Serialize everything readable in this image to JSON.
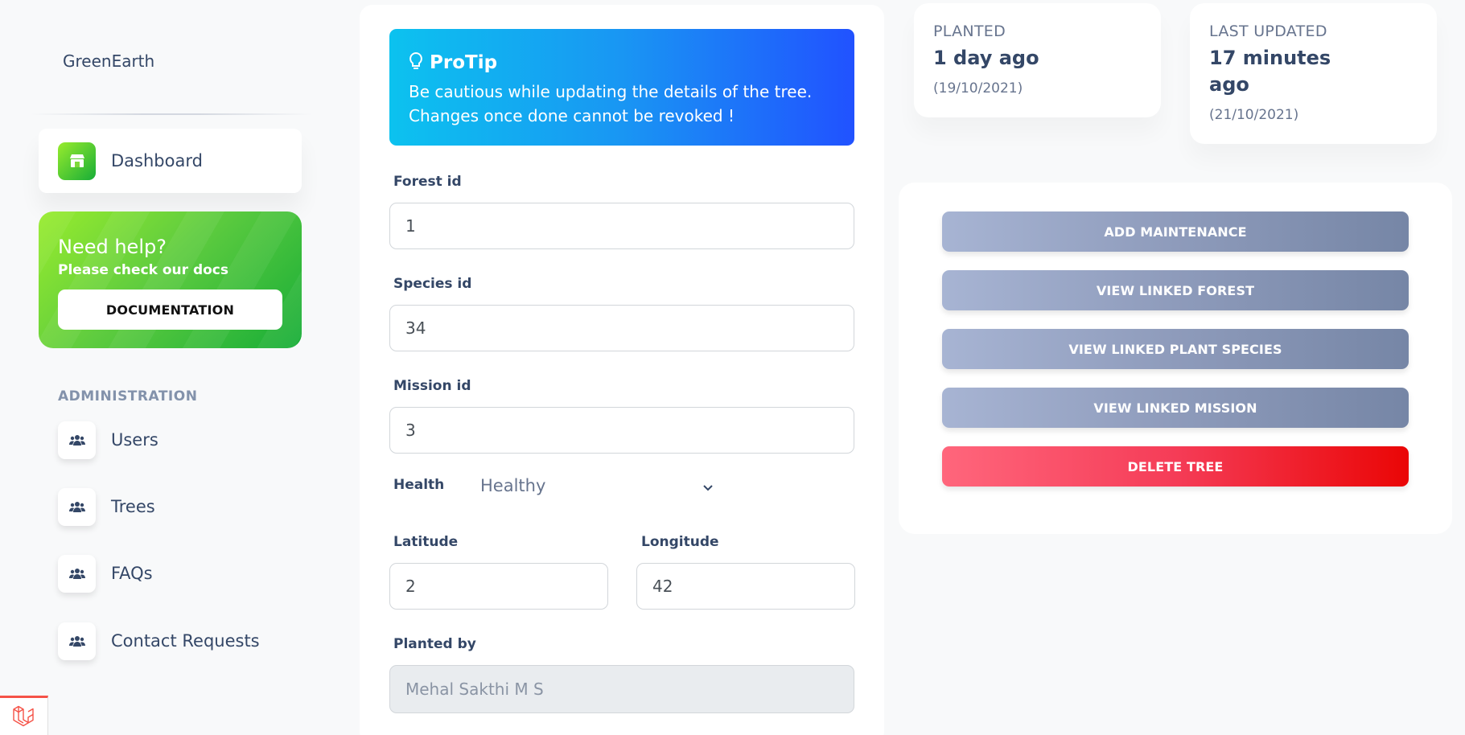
{
  "sidebar": {
    "brand": "GreenEarth",
    "active_item": {
      "label": "Dashboard",
      "icon": "shop-icon"
    },
    "help": {
      "title": "Need help?",
      "subtitle": "Please check our docs",
      "button_label": "DOCUMENTATION"
    },
    "section_heading": "ADMINISTRATION",
    "items": [
      {
        "label": "Users",
        "icon": "users-icon"
      },
      {
        "label": "Trees",
        "icon": "users-icon"
      },
      {
        "label": "FAQs",
        "icon": "users-icon"
      },
      {
        "label": "Contact Requests",
        "icon": "users-icon"
      }
    ]
  },
  "form": {
    "protip": {
      "title": "ProTip",
      "line1": "Be cautious while updating the details of the tree.",
      "line2": "Changes once done cannot be revoked !"
    },
    "forest": {
      "label": "Forest id",
      "value": "1"
    },
    "species": {
      "label": "Species id",
      "value": "34"
    },
    "mission": {
      "label": "Mission id",
      "value": "3"
    },
    "health": {
      "label": "Health",
      "value": "Healthy"
    },
    "latitude": {
      "label": "Latitude",
      "value": "2"
    },
    "longitude": {
      "label": "Longitude",
      "value": "42"
    },
    "planted_by": {
      "label": "Planted by",
      "value": "Mehal Sakthi M S"
    }
  },
  "stats": {
    "planted": {
      "label": "PLANTED",
      "value": "1 day ago",
      "date": "(19/10/2021)"
    },
    "updated": {
      "label": "LAST UPDATED",
      "value_line1": "17 minutes",
      "value_line2": "ago",
      "date": "(21/10/2021)"
    }
  },
  "actions": {
    "add_maintenance": "ADD MAINTENANCE",
    "view_forest": "VIEW LINKED FOREST",
    "view_species": "VIEW LINKED PLANT SPECIES",
    "view_mission": "VIEW LINKED MISSION",
    "delete_tree": "DELETE TREE"
  },
  "colors": {
    "protip_start": "#0cc2ef",
    "protip_end": "#2152ff",
    "help_start": "#98ec2d",
    "help_end": "#17ad37",
    "action_grey": "#8e9bbb",
    "danger": "#f53c57"
  }
}
